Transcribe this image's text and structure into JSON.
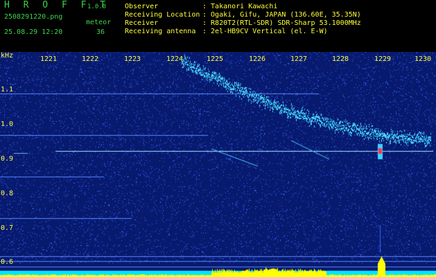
{
  "header": {
    "app_title": "H R O F F T",
    "app_version": "1.0.0",
    "file_name": "2508291220.png",
    "meteor_label": "meteor",
    "date_time": "25.08.29 12:20",
    "meteor_count": "36",
    "info": [
      {
        "label": "Observer",
        "value": ": Takanori Kawachi"
      },
      {
        "label": "Receiving Location",
        "value": ": Ogaki, Gifu, JAPAN (136.60E, 35.35N)"
      },
      {
        "label": "Receiver",
        "value": ": R820T2(RTL-SDR) SDR-Sharp 53.1000MHz"
      },
      {
        "label": "Receiving antenna",
        "value": ": 2el-HB9CV Vertical (el. E-W)"
      }
    ]
  },
  "chart_data": {
    "type": "heatmap",
    "x_tick_labels": [
      "1221",
      "1222",
      "1223",
      "1224",
      "1225",
      "1226",
      "1227",
      "1228",
      "1229",
      "1230"
    ],
    "y_unit": "kHz",
    "y_tick_labels": [
      "1.1",
      "1.0",
      "0.9",
      "0.8",
      "0.7",
      "0.6"
    ],
    "colors": {
      "background": "#071a6e",
      "noise_dot": "#3a66ff",
      "trace": "#62e0ff",
      "carrier": "#a9e9ff",
      "burst": "#ff3355",
      "strength_bar": "#ffff00",
      "baseline": "#00e5ff",
      "tick": "#ffff3a"
    }
  }
}
